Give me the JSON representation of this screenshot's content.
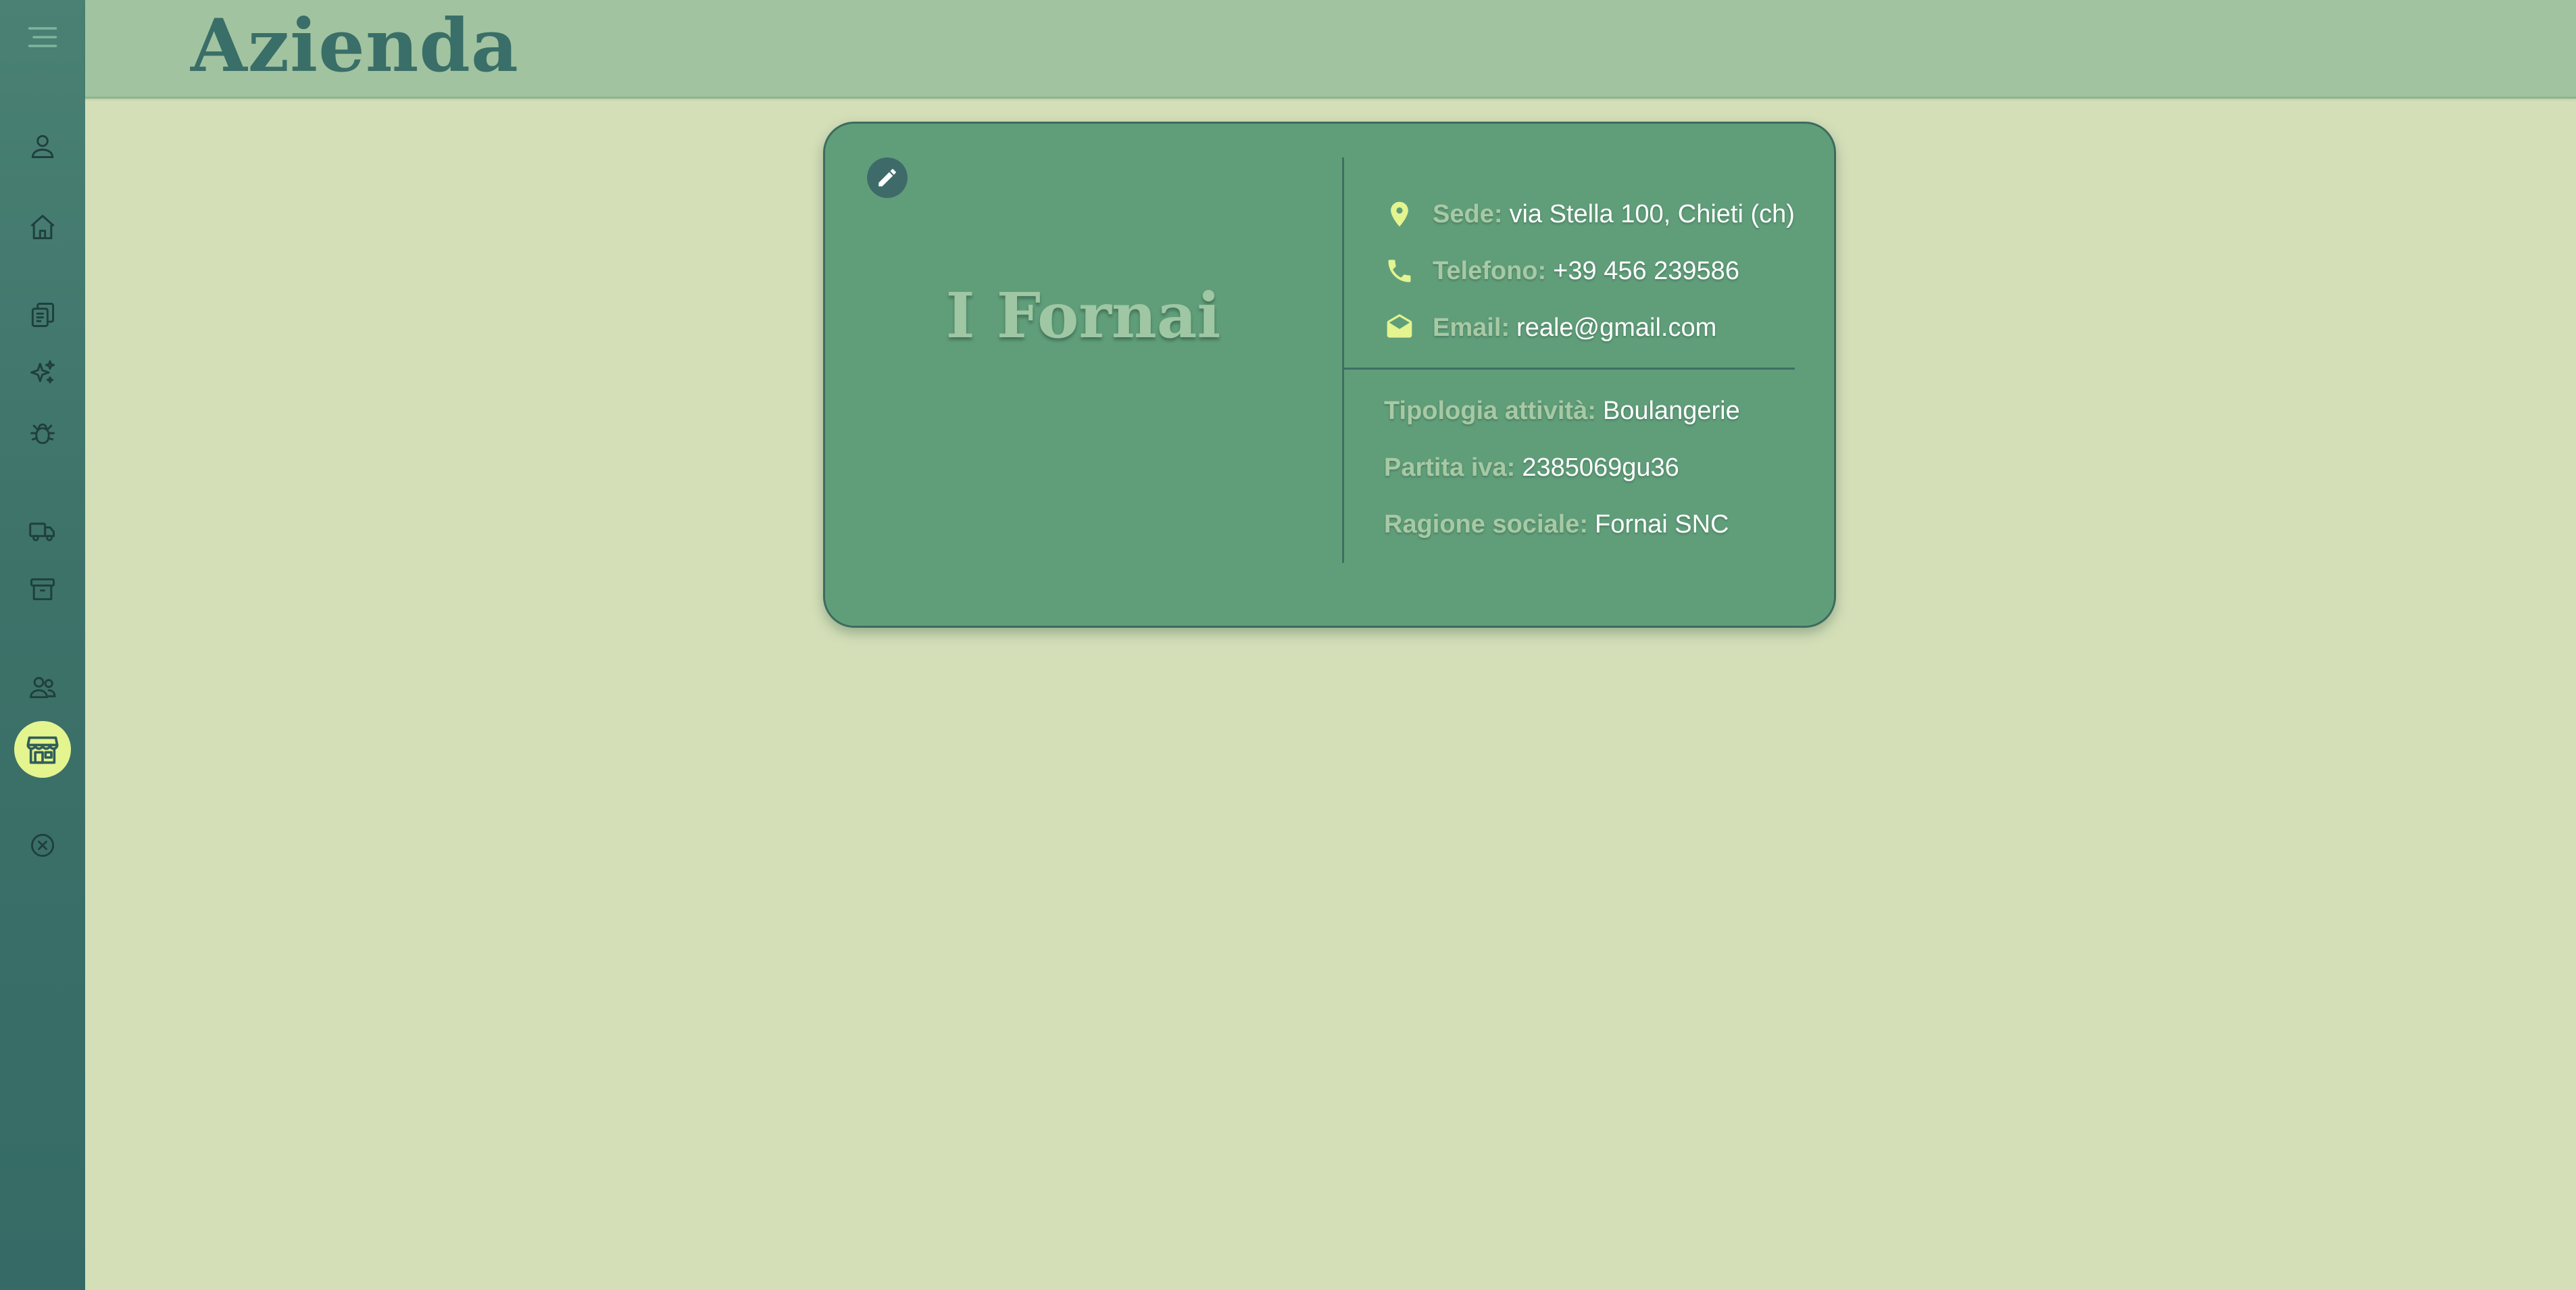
{
  "header": {
    "title": "Azienda"
  },
  "sidebar": {
    "items": [
      {
        "icon": "menu-icon",
        "active": false
      },
      {
        "icon": "user-icon",
        "active": false
      },
      {
        "icon": "home-icon",
        "active": false
      },
      {
        "icon": "documents-icon",
        "active": false
      },
      {
        "icon": "sparkles-icon",
        "active": false
      },
      {
        "icon": "bug-icon",
        "active": false
      },
      {
        "icon": "truck-icon",
        "active": false
      },
      {
        "icon": "archive-icon",
        "active": false
      },
      {
        "icon": "users-icon",
        "active": false
      },
      {
        "icon": "store-icon",
        "active": true
      },
      {
        "icon": "close-circle-icon",
        "active": false
      }
    ]
  },
  "company": {
    "name": "I Fornai",
    "contact": {
      "sede_label": "Sede:",
      "sede_value": "via Stella 100, Chieti (ch)",
      "telefono_label": "Telefono:",
      "telefono_value": "+39 456 239586",
      "email_label": "Email:",
      "email_value": "reale@gmail.com"
    },
    "details": {
      "tipologia_label": "Tipologia attività:",
      "tipologia_value": "Boulangerie",
      "piva_label": "Partita iva:",
      "piva_value": "2385069gu36",
      "ragione_label": "Ragione sociale:",
      "ragione_value": "Fornai SNC"
    }
  },
  "colors": {
    "sidebar": "#3d7269",
    "header": "#a2c3a0",
    "background": "#d4dfb8",
    "card": "#609e7a",
    "accent": "#e4f48f",
    "title": "#3a6e68"
  }
}
